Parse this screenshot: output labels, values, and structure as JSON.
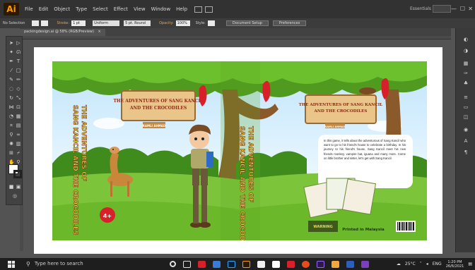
{
  "menubar": {
    "app_logo": "Ai",
    "items": [
      "File",
      "Edit",
      "Object",
      "Type",
      "Select",
      "Effect",
      "View",
      "Window",
      "Help"
    ],
    "workspace": "Essentials",
    "window_controls": [
      "—",
      "☐",
      "✕"
    ]
  },
  "control_bar": {
    "selection_label": "No Selection",
    "stroke_label": "Stroke:",
    "stroke_value": "1 pt",
    "stroke_profile": "Uniform",
    "brush": "5 pt. Round",
    "opacity_label": "Opacity:",
    "opacity_value": "100%",
    "style_label": "Style:",
    "document_setup": "Document Setup",
    "preferences": "Preferences"
  },
  "document_tab": {
    "label": "packingdesign.ai @ 58% (RGB/Preview)",
    "close": "×"
  },
  "cover": {
    "front_sign_line1": "THE ADVENTURES OF SANG KANCIL",
    "front_sign_line2": "AND THE CROCODILES",
    "front_sign_author": "RAMLI AHMAD",
    "back_sign_line1": "THE ADVENTURES OF SANG KANCIL",
    "back_sign_line2": "AND THE CROCODILES",
    "back_sign_author": "RAMLI AHMAD",
    "spine_line1": "THE ADVENTURES OF",
    "spine_line2": "SANG KANCIL AND THE CROCODILES",
    "spine_author": "RAMLI AHMAD",
    "side_line1": "THE ADVENTURES OF",
    "side_line2": "SANG KANCIL AND THE CROCODILES",
    "age_badge": "4+",
    "blurb": "In this game, it tells about the adventurous of Sang Kancil who want to go to his friend's house to celebrate a birthday. In his journey to his friend's house, Sang Kancil meet his new friends monkey, vampire bat, iguana and many more. Come on little brother and sister, let's get with Sang Kancil.",
    "warning": "WARNING",
    "printed": "Printed in Malaysia"
  },
  "taskbar": {
    "search_placeholder": "Type here to search",
    "weather": "25°C",
    "lang": "ENG",
    "time": "1:20 PM",
    "date": "26/6/2021"
  },
  "colors": {
    "menubar": "#323232",
    "workspace": "#535353",
    "ai_orange": "#ff9a00",
    "grass": "#6bb82a",
    "badge_red": "#d8202a"
  }
}
